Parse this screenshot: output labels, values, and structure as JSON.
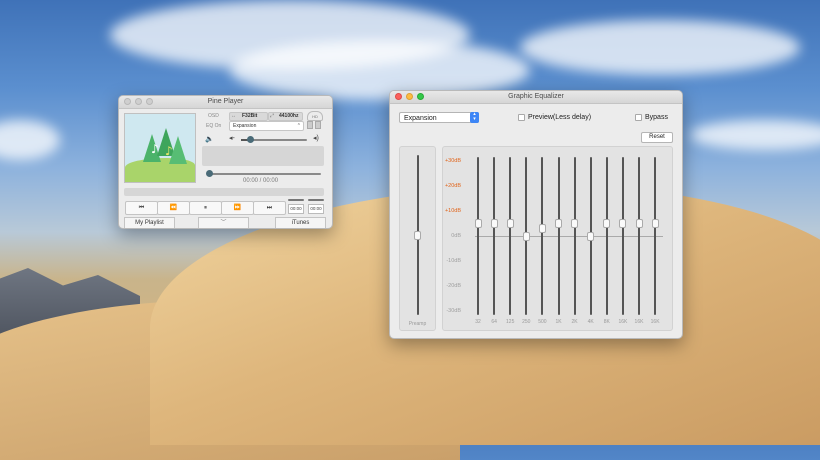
{
  "player": {
    "title": "Pine Player",
    "labels": {
      "osd": "OSD",
      "eq_on": "EQ On"
    },
    "format": "F32Bit",
    "samplerate": "44100hz",
    "eq_preset": "Expansion",
    "time_display": "00:00 / 00:00",
    "small_times": [
      "00:00",
      "00:00"
    ],
    "tabs": {
      "playlist": "My Playlist",
      "itunes": "iTunes"
    },
    "hd_label": "HD",
    "controls": [
      "⏮",
      "⏪",
      "⏸",
      "⏩",
      "⏭"
    ]
  },
  "eq": {
    "title": "Graphic Equalizer",
    "preset": "Expansion",
    "preview_label": "Preview(Less delay)",
    "bypass_label": "Bypass",
    "reset_label": "Reset",
    "preamp_label": "Preamp",
    "db_labels": [
      "+30dB",
      "+20dB",
      "+10dB",
      "0dB",
      "-10dB",
      "-20dB",
      "-30dB"
    ],
    "bands": [
      {
        "freq": "32",
        "gain": 5
      },
      {
        "freq": "64",
        "gain": 5
      },
      {
        "freq": "125",
        "gain": 5
      },
      {
        "freq": "250",
        "gain": 0
      },
      {
        "freq": "500",
        "gain": 3
      },
      {
        "freq": "1K",
        "gain": 5
      },
      {
        "freq": "2K",
        "gain": 5
      },
      {
        "freq": "4K",
        "gain": 0
      },
      {
        "freq": "8K",
        "gain": 5
      },
      {
        "freq": "16K",
        "gain": 5
      },
      {
        "freq": "",
        "gain": 5
      },
      {
        "freq": "",
        "gain": 5
      }
    ],
    "freq_labels": [
      "32",
      "64",
      "125",
      "250",
      "500",
      "1K",
      "2K",
      "4K",
      "8K",
      "16K",
      "16K",
      "16K"
    ],
    "preamp_gain": 0
  },
  "colors": {
    "db_positive": "#e0651c",
    "db_negative": "#a0a0a0",
    "accent": "#3d86f6"
  }
}
